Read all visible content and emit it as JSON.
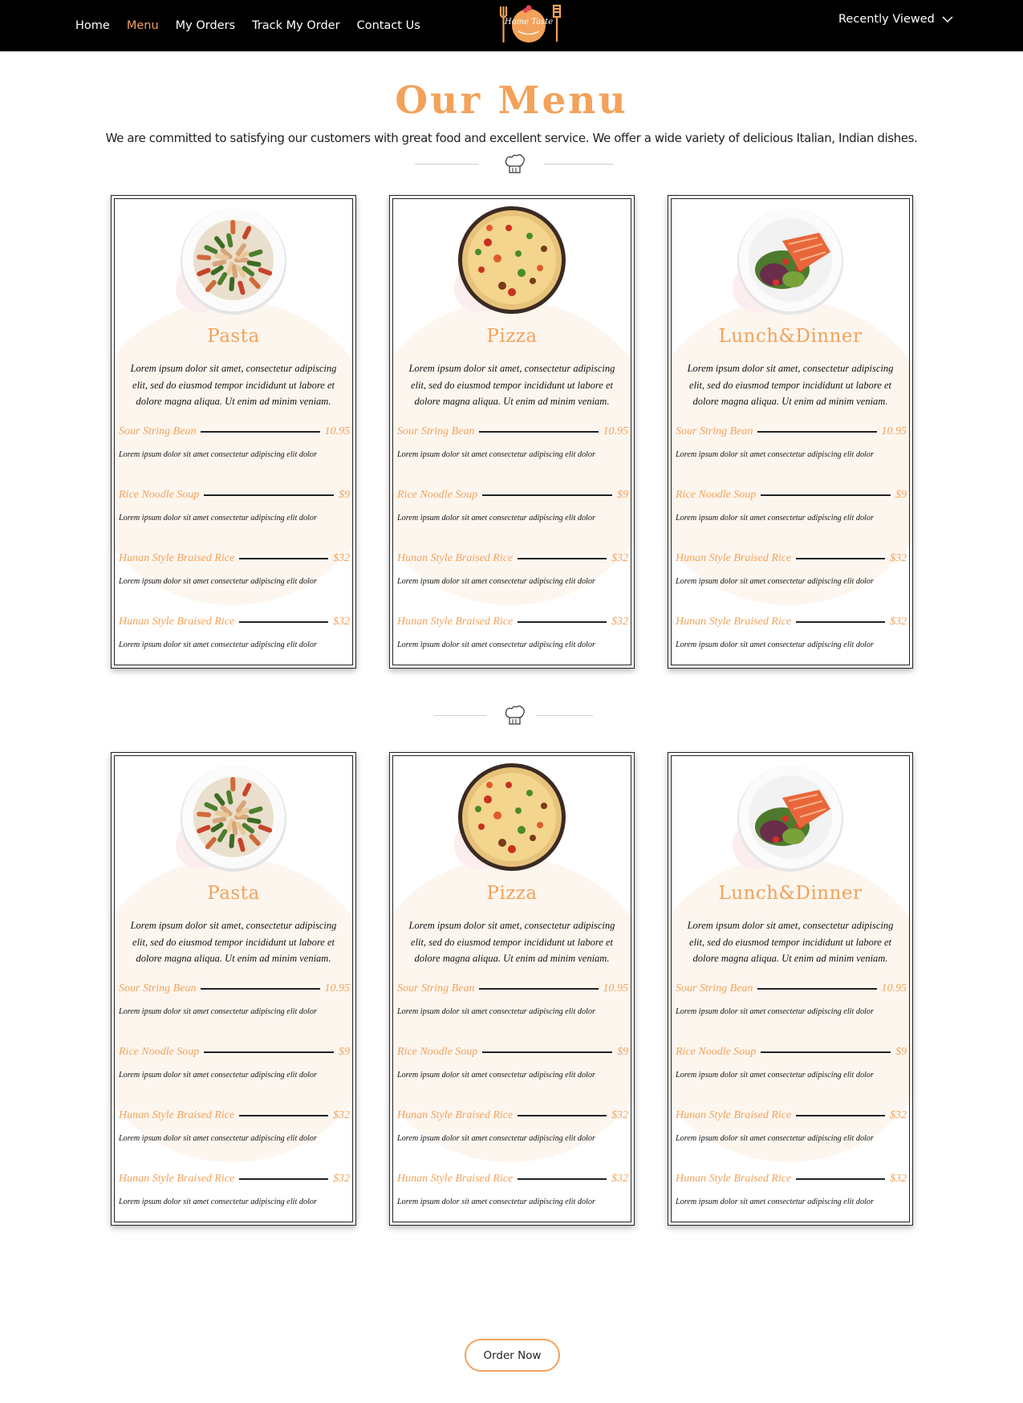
{
  "header": {
    "nav": [
      {
        "label": "Home",
        "active": false
      },
      {
        "label": "Menu",
        "active": true
      },
      {
        "label": "My Orders",
        "active": false
      },
      {
        "label": "Track My Order",
        "active": false
      },
      {
        "label": "Contact Us",
        "active": false
      }
    ],
    "logo_text": "Home Taste",
    "recently_viewed": "Recently Viewed"
  },
  "colors": {
    "accent": "#f3a25a",
    "topbar": "#000000"
  },
  "main": {
    "title": "Our Menu",
    "subtitle": "We are committed to satisfying our customers with great food and excellent service. We offer a wide variety of delicious Italian, Indian dishes.",
    "sections": [
      {
        "cards": [
          {
            "title": "Pasta",
            "image": "pasta-dish",
            "description": "Lorem ipsum dolor sit amet, consectetur adipiscing elit, sed do eiusmod tempor incididunt ut labore et dolore magna aliqua. Ut enim ad minim veniam.",
            "items": [
              {
                "name": "Sour String Bean",
                "price": "10.95",
                "desc": "Lorem ipsum dolor sit amet consectetur adipiscing elit dolor"
              },
              {
                "name": "Rice Noodle Soup",
                "price": "$9",
                "desc": "Lorem ipsum dolor sit amet consectetur adipiscing elit dolor"
              },
              {
                "name": "Hunan Style Braised Rice",
                "price": "$32",
                "desc": "Lorem ipsum dolor sit amet consectetur adipiscing elit dolor"
              },
              {
                "name": "Hunan Style Braised Rice",
                "price": "$32",
                "desc": "Lorem ipsum dolor sit amet consectetur adipiscing elit dolor"
              }
            ]
          },
          {
            "title": "Pizza",
            "image": "pizza-dish",
            "description": "Lorem ipsum dolor sit amet, consectetur adipiscing elit, sed do eiusmod tempor incididunt ut labore et dolore magna aliqua. Ut enim ad minim veniam.",
            "items": [
              {
                "name": "Sour String Bean",
                "price": "10.95",
                "desc": "Lorem ipsum dolor sit amet consectetur adipiscing elit dolor"
              },
              {
                "name": "Rice Noodle Soup",
                "price": "$9",
                "desc": "Lorem ipsum dolor sit amet consectetur adipiscing elit dolor"
              },
              {
                "name": "Hunan Style Braised Rice",
                "price": "$32",
                "desc": "Lorem ipsum dolor sit amet consectetur adipiscing elit dolor"
              },
              {
                "name": "Hunan Style Braised Rice",
                "price": "$32",
                "desc": "Lorem ipsum dolor sit amet consectetur adipiscing elit dolor"
              }
            ]
          },
          {
            "title": "Lunch&Dinner",
            "image": "salmon-salad-dish",
            "description": "Lorem ipsum dolor sit amet, consectetur adipiscing elit, sed do eiusmod tempor incididunt ut labore et dolore magna aliqua. Ut enim ad minim veniam.",
            "items": [
              {
                "name": "Sour String Bean",
                "price": "10.95",
                "desc": "Lorem ipsum dolor sit amet consectetur adipiscing elit dolor"
              },
              {
                "name": "Rice Noodle Soup",
                "price": "$9",
                "desc": "Lorem ipsum dolor sit amet consectetur adipiscing elit dolor"
              },
              {
                "name": "Hunan Style Braised Rice",
                "price": "$32",
                "desc": "Lorem ipsum dolor sit amet consectetur adipiscing elit dolor"
              },
              {
                "name": "Hunan Style Braised Rice",
                "price": "$32",
                "desc": "Lorem ipsum dolor sit amet consectetur adipiscing elit dolor"
              }
            ]
          }
        ]
      },
      {
        "cards": [
          {
            "title": "Pasta",
            "image": "pasta-dish",
            "description": "Lorem ipsum dolor sit amet, consectetur adipiscing elit, sed do eiusmod tempor incididunt ut labore et dolore magna aliqua. Ut enim ad minim veniam.",
            "items": [
              {
                "name": "Sour String Bean",
                "price": "10.95",
                "desc": "Lorem ipsum dolor sit amet consectetur adipiscing elit dolor"
              },
              {
                "name": "Rice Noodle Soup",
                "price": "$9",
                "desc": "Lorem ipsum dolor sit amet consectetur adipiscing elit dolor"
              },
              {
                "name": "Hunan Style Braised Rice",
                "price": "$32",
                "desc": "Lorem ipsum dolor sit amet consectetur adipiscing elit dolor"
              },
              {
                "name": "Hunan Style Braised Rice",
                "price": "$32",
                "desc": "Lorem ipsum dolor sit amet consectetur adipiscing elit dolor"
              }
            ]
          },
          {
            "title": "Pizza",
            "image": "pizza-dish",
            "description": "Lorem ipsum dolor sit amet, consectetur adipiscing elit, sed do eiusmod tempor incididunt ut labore et dolore magna aliqua. Ut enim ad minim veniam.",
            "items": [
              {
                "name": "Sour String Bean",
                "price": "10.95",
                "desc": "Lorem ipsum dolor sit amet consectetur adipiscing elit dolor"
              },
              {
                "name": "Rice Noodle Soup",
                "price": "$9",
                "desc": "Lorem ipsum dolor sit amet consectetur adipiscing elit dolor"
              },
              {
                "name": "Hunan Style Braised Rice",
                "price": "$32",
                "desc": "Lorem ipsum dolor sit amet consectetur adipiscing elit dolor"
              },
              {
                "name": "Hunan Style Braised Rice",
                "price": "$32",
                "desc": "Lorem ipsum dolor sit amet consectetur adipiscing elit dolor"
              }
            ]
          },
          {
            "title": "Lunch&Dinner",
            "image": "salmon-salad-dish",
            "description": "Lorem ipsum dolor sit amet, consectetur adipiscing elit, sed do eiusmod tempor incididunt ut labore et dolore magna aliqua. Ut enim ad minim veniam.",
            "items": [
              {
                "name": "Sour String Bean",
                "price": "10.95",
                "desc": "Lorem ipsum dolor sit amet consectetur adipiscing elit dolor"
              },
              {
                "name": "Rice Noodle Soup",
                "price": "$9",
                "desc": "Lorem ipsum dolor sit amet consectetur adipiscing elit dolor"
              },
              {
                "name": "Hunan Style Braised Rice",
                "price": "$32",
                "desc": "Lorem ipsum dolor sit amet consectetur adipiscing elit dolor"
              },
              {
                "name": "Hunan Style Braised Rice",
                "price": "$32",
                "desc": "Lorem ipsum dolor sit amet consectetur adipiscing elit dolor"
              }
            ]
          }
        ]
      }
    ],
    "order_button": "Order Now"
  }
}
